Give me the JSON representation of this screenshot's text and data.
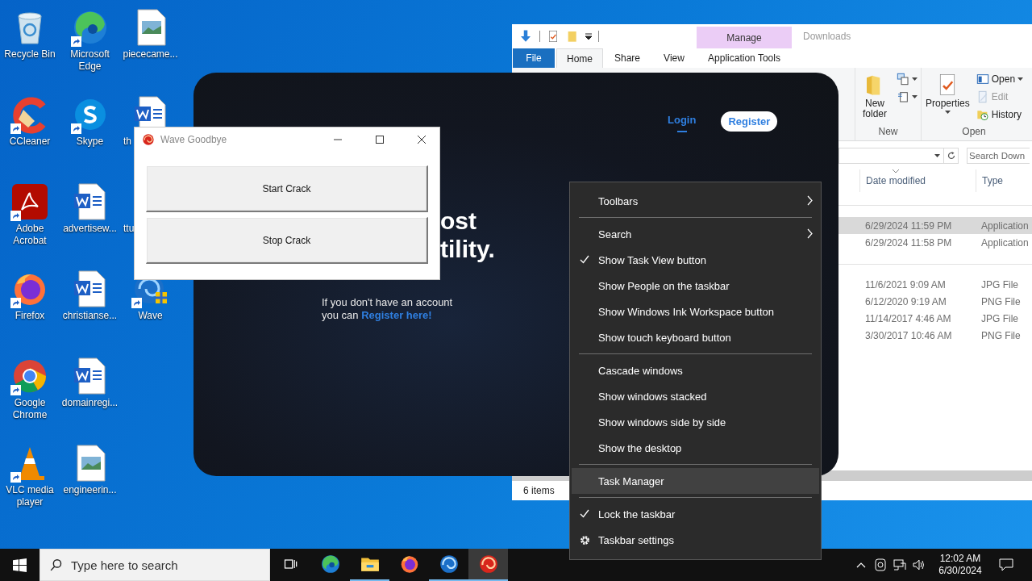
{
  "desktop_icons": [
    {
      "label": "Recycle Bin",
      "kind": "recycle",
      "shortcut": false,
      "clipped": false
    },
    {
      "label": "CCleaner",
      "kind": "ccleaner",
      "shortcut": true,
      "clipped": false
    },
    {
      "label": "Adobe Acrobat",
      "kind": "acrobat",
      "shortcut": true,
      "clipped": false
    },
    {
      "label": "Firefox",
      "kind": "firefox",
      "shortcut": true,
      "clipped": false
    },
    {
      "label": "Google Chrome",
      "kind": "chrome",
      "shortcut": true,
      "clipped": false
    },
    {
      "label": "VLC media player",
      "kind": "vlc",
      "shortcut": true,
      "clipped": false
    },
    {
      "label": "Microsoft Edge",
      "kind": "edge",
      "shortcut": true,
      "clipped": false
    },
    {
      "label": "Skype",
      "kind": "skype",
      "shortcut": true,
      "clipped": false
    },
    {
      "label": "advertisew...",
      "kind": "word",
      "shortcut": false,
      "clipped": false
    },
    {
      "label": "christianse...",
      "kind": "word",
      "shortcut": false,
      "clipped": false
    },
    {
      "label": "domainregi...",
      "kind": "word",
      "shortcut": false,
      "clipped": false
    },
    {
      "label": "engineerin...",
      "kind": "image",
      "shortcut": false,
      "clipped": false
    },
    {
      "label": "piececame...",
      "kind": "image",
      "shortcut": false,
      "clipped": false
    },
    {
      "label": "th",
      "kind": "word",
      "shortcut": false,
      "clipped": true
    },
    {
      "label": "ttu",
      "shortcut": false,
      "clipped": true
    },
    {
      "label": "Wave",
      "kind": "wave",
      "shortcut": true,
      "clipped": false
    }
  ],
  "explorer": {
    "context_tab": "Manage",
    "title": "Downloads",
    "tabs": [
      {
        "label": "File",
        "kind": "file",
        "selected": false
      },
      {
        "label": "Home",
        "kind": "tab",
        "selected": true
      },
      {
        "label": "Share",
        "kind": "tab",
        "selected": false
      },
      {
        "label": "View",
        "kind": "tab",
        "selected": false
      },
      {
        "label": "Application Tools",
        "kind": "tab",
        "selected": false
      }
    ],
    "ribbon_groups": [
      {
        "label": "New",
        "large": {
          "label": "New folder",
          "kind": "folder",
          "caret": false
        },
        "small": [
          {
            "kind": "new-item",
            "caret": true
          },
          {
            "kind": "easy-access",
            "caret": true
          }
        ]
      },
      {
        "label": "Open",
        "large": {
          "label": "Properties",
          "kind": "properties",
          "caret": true
        },
        "small": [
          {
            "kind": "open",
            "label": "Open",
            "caret": true,
            "disabled": false
          },
          {
            "kind": "edit",
            "label": "Edit",
            "caret": false,
            "disabled": true
          },
          {
            "kind": "history",
            "label": "History",
            "caret": false,
            "disabled": false
          }
        ]
      }
    ],
    "search": {
      "placeholder": "Search Down"
    },
    "columns": [
      "Date modified",
      "Type"
    ],
    "file_groups": [
      {
        "rows": [
          {
            "date_modified": "6/29/2024 11:59 PM",
            "type": "Application",
            "selected": true
          },
          {
            "date_modified": "6/29/2024 11:58 PM",
            "type": "Application",
            "selected": false
          }
        ]
      },
      {
        "rows": [
          {
            "date_modified": "11/6/2021 9:09 AM",
            "type": "JPG File",
            "selected": false
          },
          {
            "date_modified": "6/12/2020 9:19 AM",
            "type": "PNG File",
            "selected": false
          },
          {
            "date_modified": "11/14/2017 4:46 AM",
            "type": "JPG File",
            "selected": false
          },
          {
            "date_modified": "3/30/2017 10:46 AM",
            "type": "PNG File",
            "selected": false
          }
        ]
      }
    ],
    "status": "6 items"
  },
  "wave_app": {
    "nav": [
      {
        "label": "Login",
        "kind": "link",
        "selected": true
      },
      {
        "label": "Register",
        "kind": "pill",
        "selected": false
      }
    ],
    "heading_lines": [
      "ost",
      "tility."
    ],
    "prompt_lines": [
      "If you don't have an account",
      "you can"
    ],
    "prompt_link": "Register here!"
  },
  "goodbye_window": {
    "title": "Wave Goodbye",
    "buttons": [
      "Start Crack",
      "Stop Crack"
    ]
  },
  "context_menu": [
    {
      "kind": "item",
      "label": "Toolbars",
      "checked": false,
      "submenu": true,
      "selected": false
    },
    {
      "kind": "separator"
    },
    {
      "kind": "item",
      "label": "Search",
      "checked": false,
      "submenu": true,
      "selected": false
    },
    {
      "kind": "item",
      "label": "Show Task View button",
      "checked": true,
      "submenu": false,
      "selected": false
    },
    {
      "kind": "item",
      "label": "Show People on the taskbar",
      "checked": false,
      "submenu": false,
      "selected": false
    },
    {
      "kind": "item",
      "label": "Show Windows Ink Workspace button",
      "checked": false,
      "submenu": false,
      "selected": false
    },
    {
      "kind": "item",
      "label": "Show touch keyboard button",
      "checked": false,
      "submenu": false,
      "selected": false
    },
    {
      "kind": "separator"
    },
    {
      "kind": "item",
      "label": "Cascade windows",
      "checked": false,
      "submenu": false,
      "selected": false
    },
    {
      "kind": "item",
      "label": "Show windows stacked",
      "checked": false,
      "submenu": false,
      "selected": false
    },
    {
      "kind": "item",
      "label": "Show windows side by side",
      "checked": false,
      "submenu": false,
      "selected": false
    },
    {
      "kind": "item",
      "label": "Show the desktop",
      "checked": false,
      "submenu": false,
      "selected": false
    },
    {
      "kind": "separator"
    },
    {
      "kind": "item",
      "label": "Task Manager",
      "checked": false,
      "submenu": false,
      "selected": true
    },
    {
      "kind": "separator"
    },
    {
      "kind": "item",
      "label": "Lock the taskbar",
      "checked": true,
      "submenu": false,
      "selected": false
    },
    {
      "kind": "settings",
      "label": "Taskbar settings",
      "checked": false,
      "submenu": false,
      "selected": false
    }
  ],
  "taskbar": {
    "search_placeholder": "Type here to search",
    "apps": [
      {
        "kind": "task-view",
        "running": false,
        "active": false
      },
      {
        "kind": "edge",
        "running": false,
        "active": false
      },
      {
        "kind": "explorer",
        "running": true,
        "active": false
      },
      {
        "kind": "firefox",
        "running": false,
        "active": false
      },
      {
        "kind": "wave",
        "running": true,
        "active": false
      },
      {
        "kind": "goodbye",
        "running": true,
        "active": true
      }
    ],
    "time": "12:02 AM",
    "date": "6/30/2024"
  }
}
